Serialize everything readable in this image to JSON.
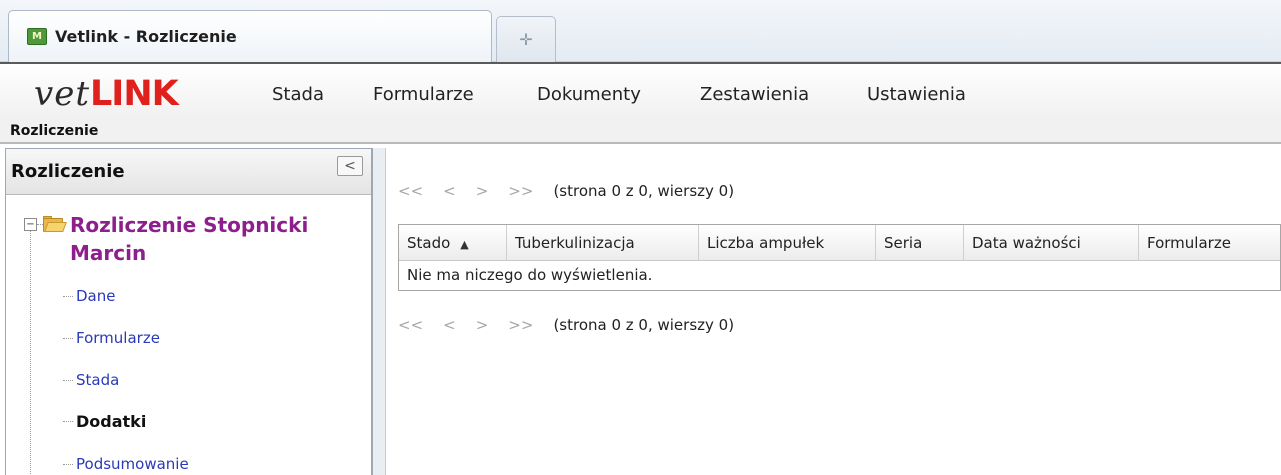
{
  "browser": {
    "tab_title": "Vetlink - Rozliczenie",
    "favicon_text": "M",
    "new_tab_icon": "plus-icon"
  },
  "app": {
    "logo_vet": "vet",
    "logo_link": "LINK",
    "menu": [
      "Stada",
      "Formularze",
      "Dokumenty",
      "Zestawienia",
      "Ustawienia"
    ]
  },
  "breadcrumb": "Rozliczenie",
  "sidebar": {
    "title": "Rozliczenie",
    "collapse_glyph": "<",
    "tree_root": "Rozliczenie Stopnicki Marcin",
    "children": [
      "Dane",
      "Formularze",
      "Stada",
      "Dodatki",
      "Podsumowanie"
    ],
    "selected_child": "Dodatki"
  },
  "grid": {
    "pager": {
      "first": "<<",
      "prev": "<",
      "next": ">",
      "last": ">>",
      "status": "(strona 0 z 0, wierszy 0)"
    },
    "columns": [
      "Stado",
      "Tuberkulinizacja",
      "Liczba ampułek",
      "Seria",
      "Data ważności",
      "Formularze"
    ],
    "sort_column": "Stado",
    "sort_glyph": "▲",
    "empty_message": "Nie ma niczego do wyświetlenia."
  },
  "colors": {
    "logo_red": "#e0201c",
    "tree_root_purple": "#8d1f8d",
    "link_blue": "#2a39b8"
  }
}
